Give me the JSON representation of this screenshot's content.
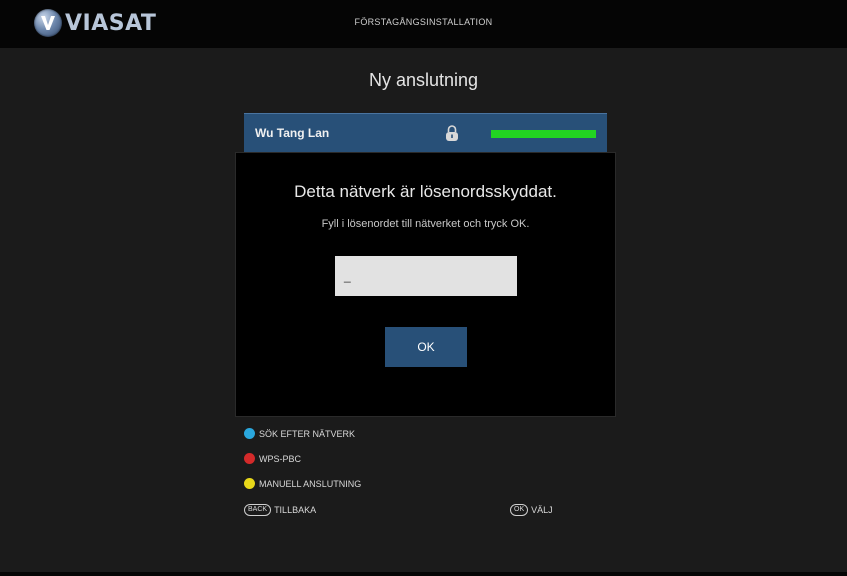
{
  "header": {
    "logo_text": "VIASAT",
    "title": "FÖRSTAGÅNGSINSTALLATION"
  },
  "page_title": "Ny anslutning",
  "network": {
    "name": "Wu Tang Lan",
    "secured_icon": "lock-icon",
    "signal_level": 1.0,
    "signal_color": "#22d422"
  },
  "dialog": {
    "title": "Detta nätverk är lösenordsskyddat.",
    "message": "Fyll i lösenordet till nätverket och tryck OK.",
    "password_value": "_",
    "ok_label": "OK"
  },
  "actions": {
    "search": {
      "label": "SÖK EFTER NÄTVERK",
      "color": "#2aa7dd"
    },
    "wps": {
      "label": "WPS-PBC",
      "color": "#d42a2a"
    },
    "manual": {
      "label": "MANUELL ANSLUTNING",
      "color": "#e8d81a"
    },
    "back": {
      "key": "BACK",
      "label": "TILLBAKA"
    },
    "select": {
      "key": "OK",
      "label": "VÄLJ"
    }
  },
  "colors": {
    "accent": "#285078",
    "background": "#1b1b1b"
  }
}
